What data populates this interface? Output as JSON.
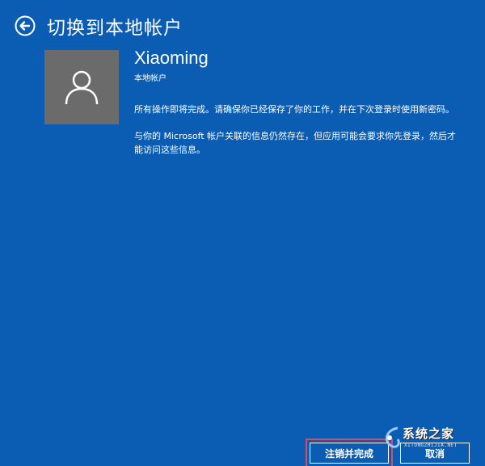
{
  "header": {
    "title": "切换到本地帐户",
    "back_icon": "back-arrow-circle-icon"
  },
  "account": {
    "avatar_icon": "user-silhouette-icon",
    "name": "Xiaoming",
    "type": "本地帐户"
  },
  "messages": {
    "para1": "所有操作即将完成。请确保你已经保存了你的工作，并在下次登录时使用新密码。",
    "para2": "与你的 Microsoft 帐户关联的信息仍然存在，但应用可能会要求你先登录，然后才能访问这些信息。"
  },
  "buttons": {
    "primary_label": "注销并完成",
    "cancel_label": "取消"
  },
  "watermark": {
    "text": "系统之家",
    "sub": "XITONGZHIJIA.NET"
  },
  "colors": {
    "background": "#0b5cb3",
    "avatar_bg": "#6b6b6b",
    "highlight": "#e14a5a"
  }
}
